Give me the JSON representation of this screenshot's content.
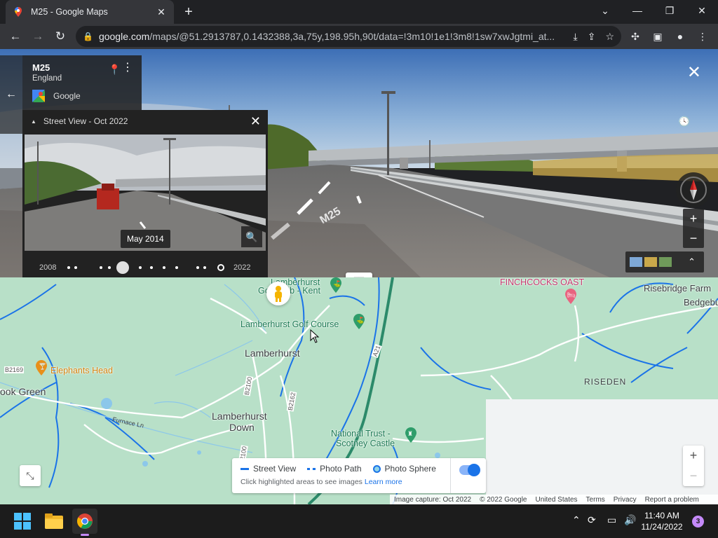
{
  "browser": {
    "tab_title": "M25 - Google Maps",
    "tab_close": "✕",
    "new_tab": "+",
    "url_domain": "google.com",
    "url_path": "/maps/@51.2913787,0.1432388,3a,75y,198.95h,90t/data=!3m10!1e1!3m8!1sw7xwJgtmi_at..."
  },
  "streetview": {
    "close": "✕",
    "address_title": "M25",
    "address_region": "England",
    "source": "Google",
    "back_arrow": "←",
    "time_panel": {
      "title": "Street View - Oct 2022",
      "selected_date": "May 2014",
      "year_start": "2008",
      "year_end": "2022"
    },
    "zoom_in": "+",
    "zoom_out": "−",
    "expand": "⌃"
  },
  "map": {
    "labels": {
      "lamberhurst_golf_club": "Lamberhurst",
      "golf_club_kent": "Golf Club - Kent",
      "lamberhurst_golf_course": "Lamberhurst Golf Course",
      "lamberhurst": "Lamberhurst",
      "elephants_head": "Elephants Head",
      "brook_green": "ook Green",
      "lamberhurst_down_1": "Lamberhurst",
      "lamberhurst_down_2": "Down",
      "national_trust_1": "National Trust -",
      "national_trust_2": "Scotney Castle",
      "finchcocks": "FINCHCOCKS OAST",
      "risebridge": "Risebridge Farm",
      "bedgebury": "Bedgebur",
      "riseden": "RISEDEN",
      "furnace_ln": "Furnace Ln",
      "road_a21": "A21",
      "road_b2169": "B2169",
      "road_b2100": "B2100",
      "road_b2162": "B2162",
      "road_b2100b": "2100"
    },
    "zoom_in": "+",
    "zoom_out": "−",
    "legend": {
      "street_view": "Street View",
      "photo_path": "Photo Path",
      "photo_sphere": "Photo Sphere",
      "hint": "Click highlighted areas to see images",
      "learn_more": "Learn more"
    },
    "footer": {
      "image_capture": "Image capture: Oct 2022",
      "copyright": "© 2022 Google",
      "country": "United States",
      "terms": "Terms",
      "privacy": "Privacy",
      "report": "Report a problem"
    }
  },
  "taskbar": {
    "time": "11:40 AM",
    "date": "11/24/2022",
    "notifications": "3"
  },
  "colors": {
    "map_green": "#b8e0c8",
    "water_blue": "#1a73e8",
    "chrome_dark": "#202124",
    "chrome_toolbar": "#35363a"
  }
}
